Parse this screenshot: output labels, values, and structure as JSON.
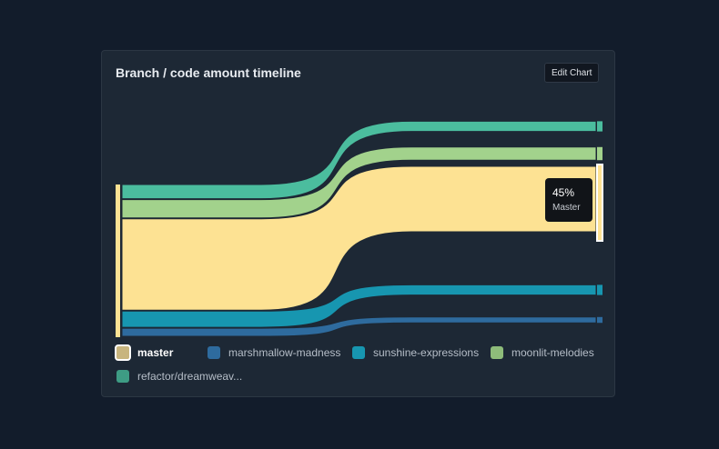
{
  "title": "Branch / code amount timeline",
  "edit_button": "Edit Chart",
  "tooltip": {
    "value": "45%",
    "label": "Master"
  },
  "chart_data": {
    "type": "sankey",
    "title": "Branch / code amount timeline",
    "source": "master",
    "flows": [
      {
        "branch": "refactor/dreamweav...",
        "start_share": 0.07,
        "end_share": 0.07,
        "color": "#4bbd9e"
      },
      {
        "branch": "moonlit-melodies",
        "start_share": 0.09,
        "end_share": 0.09,
        "color": "#a2d28c"
      },
      {
        "branch": "master",
        "start_share": 0.45,
        "end_share": 0.45,
        "color": "#fde293"
      },
      {
        "branch": "sunshine-expressions",
        "start_share": 0.08,
        "end_share": 0.07,
        "color": "#1796b0"
      },
      {
        "branch": "marshmallow-madness",
        "start_share": 0.04,
        "end_share": 0.04,
        "color": "#2e6b9e"
      }
    ],
    "highlighted": "master"
  },
  "legend": [
    {
      "label": "master",
      "color": "#c8b57e",
      "active": true
    },
    {
      "label": "marshmallow-madness",
      "color": "#2e6b9e",
      "active": false
    },
    {
      "label": "sunshine-expressions",
      "color": "#1796b0",
      "active": false
    },
    {
      "label": "moonlit-melodies",
      "color": "#8ebc7a",
      "active": false
    },
    {
      "label": "refactor/dreamweav...",
      "color": "#3e9c84",
      "active": false
    }
  ]
}
